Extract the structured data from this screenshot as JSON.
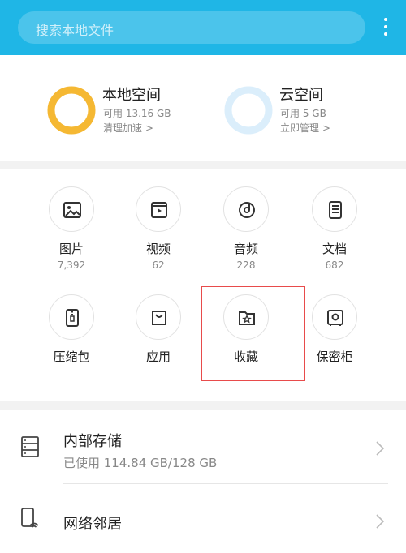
{
  "search": {
    "placeholder": "搜索本地文件"
  },
  "storage": {
    "local": {
      "title": "本地空间",
      "available": "可用 13.16 GB",
      "action": "清理加速 >"
    },
    "cloud": {
      "title": "云空间",
      "available": "可用 5 GB",
      "action": "立即管理 >"
    }
  },
  "categories": [
    {
      "label": "图片",
      "count": "7,392",
      "icon": "image-icon"
    },
    {
      "label": "视频",
      "count": "62",
      "icon": "video-icon"
    },
    {
      "label": "音频",
      "count": "228",
      "icon": "audio-icon"
    },
    {
      "label": "文档",
      "count": "682",
      "icon": "document-icon"
    },
    {
      "label": "压缩包",
      "icon": "zip-icon"
    },
    {
      "label": "应用",
      "icon": "app-bag-icon"
    },
    {
      "label": "收藏",
      "icon": "favorite-folder-icon"
    },
    {
      "label": "保密柜",
      "icon": "safe-icon"
    }
  ],
  "list": {
    "internal": {
      "title": "内部存储",
      "usage": "已使用 114.84 GB/128 GB"
    },
    "network": {
      "title": "网络邻居"
    }
  },
  "colors": {
    "accent": "#1fb6e6",
    "ring_local": "#f5b833",
    "ring_cloud": "#dbeefb",
    "highlight": "#e84b4b"
  }
}
